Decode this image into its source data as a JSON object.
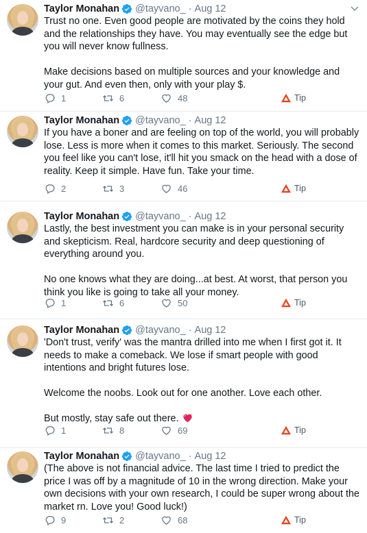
{
  "colors": {
    "text_primary": "#14171a",
    "text_secondary": "#657786",
    "verified_blue": "#1da1f2",
    "divider": "#e6ecf0",
    "tip_orange": "#e8441d",
    "emoji_heart": "#e0245e"
  },
  "tweets": [
    {
      "author": {
        "name": "Taylor Monahan",
        "handle": "@tayvano_",
        "separator": "·",
        "date": "Aug 12"
      },
      "paragraphs": [
        "Trust no one. Even good people are motivated by the coins they hold and the relationships they have. You may eventually see the edge but you will never know fullness.",
        "Make decisions based on multiple sources and your knowledge and your gut. And even then, only with your play $."
      ],
      "actions": {
        "replies": "1",
        "retweets": "6",
        "likes": "48",
        "tip_label": "Tip"
      }
    },
    {
      "author": {
        "name": "Taylor Monahan",
        "handle": "@tayvano_",
        "separator": "·",
        "date": "Aug 12"
      },
      "paragraphs": [
        "If you have a boner and are feeling on top of the world, you will probably lose. Less is more when it comes to this market. Seriously. The second you feel like you can't lose, it'll hit you smack on the head with a dose of reality. Keep it simple. Have fun. Take your time."
      ],
      "actions": {
        "replies": "2",
        "retweets": "3",
        "likes": "46",
        "tip_label": "Tip"
      }
    },
    {
      "author": {
        "name": "Taylor Monahan",
        "handle": "@tayvano_",
        "separator": "·",
        "date": "Aug 12"
      },
      "paragraphs": [
        "Lastly, the best investment you can make is in your personal security and skepticism. Real, hardcore security and deep questioning of everything around you.",
        "No one knows what they are doing...at best. At worst, that person you think you like is going to take all your money."
      ],
      "actions": {
        "replies": "1",
        "retweets": "6",
        "likes": "50",
        "tip_label": "Tip"
      }
    },
    {
      "author": {
        "name": "Taylor Monahan",
        "handle": "@tayvano_",
        "separator": "·",
        "date": "Aug 12"
      },
      "paragraphs": [
        "'Don't trust, verify' was the mantra drilled into me when I first got it. It needs to make a comeback. We lose if smart people with good intentions and bright futures lose.",
        "Welcome the noobs. Look out for one another. Love each other.",
        "But mostly, stay safe out there."
      ],
      "emoji": "sparkling-heart-icon",
      "actions": {
        "replies": "1",
        "retweets": "8",
        "likes": "69",
        "tip_label": "Tip"
      }
    },
    {
      "author": {
        "name": "Taylor Monahan",
        "handle": "@tayvano_",
        "separator": "·",
        "date": "Aug 12"
      },
      "paragraphs": [
        "(The above is not financial advice. The last time I tried to predict the price I was off by a magnitude of 10 in the wrong direction. Make your own decisions with your own research, I could be super wrong about the market rn. Love you! Good luck!)"
      ],
      "actions": {
        "replies": "9",
        "retweets": "2",
        "likes": "68",
        "tip_label": "Tip"
      }
    }
  ]
}
